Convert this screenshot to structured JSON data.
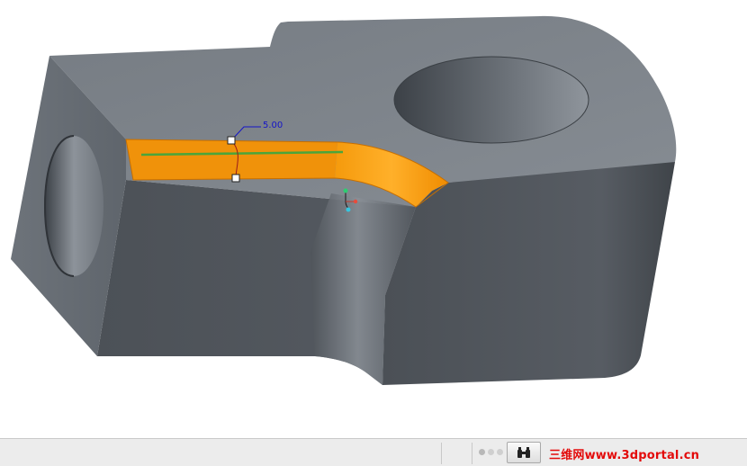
{
  "viewport": {
    "dimension_value": "5.00",
    "colors": {
      "background": "#ffffff",
      "part_top": "#7d838a",
      "part_front": "#50555c",
      "part_side": "#5c6168",
      "selected_surface": "#f0920a",
      "trajectory": "#4aa53b",
      "dimension": "#1515c8"
    }
  },
  "statusbar": {
    "icons": [
      "status-dots-icon",
      "find-binoculars-icon"
    ],
    "watermark": "三维网www.3dportal.cn"
  }
}
